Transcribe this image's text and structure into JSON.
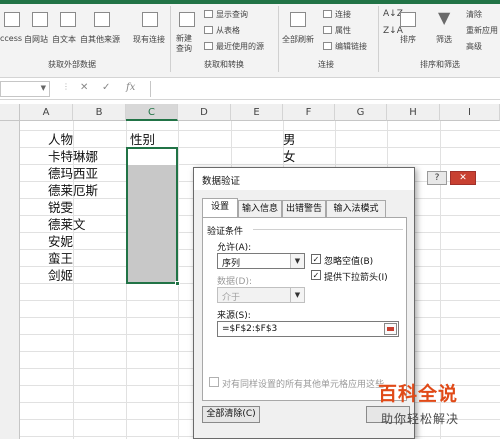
{
  "ribbon": {
    "accent_color": "#217346",
    "buttons": [
      {
        "label": "ccess"
      },
      {
        "label": "自网站"
      },
      {
        "label": "自文本"
      },
      {
        "label": "自其他来源"
      },
      {
        "label": "现有连接"
      },
      {
        "label": "新建\n查询"
      },
      {
        "label": "全部刷新"
      },
      {
        "label": "排序"
      },
      {
        "label": "筛选"
      }
    ],
    "small_items": [
      {
        "label": "显示查询"
      },
      {
        "label": "从表格"
      },
      {
        "label": "最近使用的源"
      },
      {
        "label": "连接"
      },
      {
        "label": "属性"
      },
      {
        "label": "编辑链接"
      },
      {
        "label": "清除"
      },
      {
        "label": "重新应用"
      },
      {
        "label": "高级"
      }
    ],
    "groups": [
      {
        "label": "获取外部数据"
      },
      {
        "label": "获取和转换"
      },
      {
        "label": "连接"
      },
      {
        "label": "排序和筛选"
      }
    ]
  },
  "formula_bar": {
    "fx_label": "fx"
  },
  "columns": [
    "A",
    "B",
    "C",
    "D",
    "E",
    "F",
    "G",
    "H",
    "I"
  ],
  "cells": {
    "b_col": [
      "人物",
      "卡特琳娜",
      "德玛西亚",
      "德莱厄斯",
      "锐雯",
      "德莱文",
      "安妮",
      "蛮王",
      "剑姬"
    ],
    "c1": "性别",
    "f1": "男",
    "f2": "女"
  },
  "dialog": {
    "title": "数据验证",
    "help_btn": "?",
    "close_btn": "✕",
    "tabs": [
      "设置",
      "输入信息",
      "出错警告",
      "输入法模式"
    ],
    "section": "验证条件",
    "allow_label": "允许(A):",
    "allow_value": "序列",
    "ignore_blank": "忽略空值(B)",
    "dropdown_arrow": "提供下拉箭头(I)",
    "data_label": "数据(D):",
    "data_value": "介于",
    "source_label": "来源(S):",
    "source_value": "=$F$2:$F$3",
    "apply_all": "对有同样设置的所有其他单元格应用这些",
    "clear_all": "全部清除(C)"
  },
  "watermark": {
    "line1": "百科全说",
    "line2": "助你轻松解决"
  }
}
